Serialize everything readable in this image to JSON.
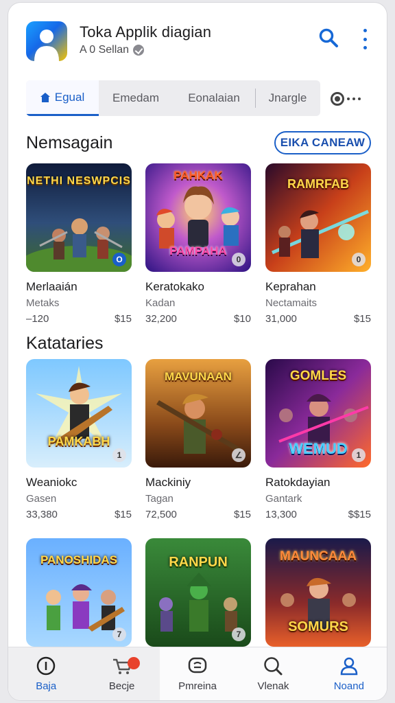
{
  "header": {
    "app_title": "Toka Applik diagian",
    "app_subtitle": "A 0 Sellan",
    "app_icon": "person-avatar-icon",
    "search_icon": "search-icon",
    "more_icon": "more-vertical-icon"
  },
  "tabs": [
    {
      "label": "Egual",
      "active": true,
      "icon": "home-icon"
    },
    {
      "label": "Emedam",
      "active": false
    },
    {
      "label": "Eonalaian",
      "active": false
    },
    {
      "label": "Jnargle",
      "active": false
    }
  ],
  "section1": {
    "title": "Nemsagain",
    "action_label": "EIKA CANEAW",
    "items": [
      {
        "name": "Merlaaián",
        "sub": "Metaks",
        "count": "–120",
        "price": "$15",
        "art_title": "NETHI NESWPCIS",
        "badge": "O"
      },
      {
        "name": "Keratokako",
        "sub": "Kadan",
        "count": "32,200",
        "price": "$10",
        "art_title": "PAHKAK",
        "art_title2": "PAMPAHA",
        "badge": "0"
      },
      {
        "name": "Keprahan",
        "sub": "Nectamaits",
        "count": "31,000",
        "price": "$15",
        "art_title": "RAMRFAB",
        "badge": "0"
      }
    ]
  },
  "section2": {
    "title": "Katataries",
    "items": [
      {
        "name": "Weaniokc",
        "sub": "Gasen",
        "count": "33,380",
        "price": "$15",
        "art_title": "PAMKABH",
        "badge": "1"
      },
      {
        "name": "Mackiniy",
        "sub": "Tagan",
        "count": "72,500",
        "price": "$15",
        "art_title": "MAVUNAAN",
        "badge": "∠"
      },
      {
        "name": "Ratokdayian",
        "sub": "Gantark",
        "count": "13,300",
        "price": "$$15",
        "art_title": "GOMLES",
        "art_title2": "WEMUD",
        "badge": "1"
      }
    ]
  },
  "section3": {
    "items": [
      {
        "art_title": "PANOSHIDAS",
        "badge": "7"
      },
      {
        "art_title": "RANPUN",
        "badge": "7"
      },
      {
        "art_title": "MAUNCAAA",
        "art_title2": "SOMURS",
        "badge": ""
      }
    ]
  },
  "bottom_nav": [
    {
      "label": "Baja",
      "icon": "info-circle-icon",
      "active": true
    },
    {
      "label": "Becje",
      "icon": "cart-icon",
      "active": false
    },
    {
      "label": "Pmreina",
      "icon": "chat-icon",
      "active": false
    },
    {
      "label": "Vlenak",
      "icon": "search-icon",
      "active": false
    },
    {
      "label": "Noand",
      "icon": "profile-icon",
      "active": false
    }
  ],
  "colors": {
    "accent": "#1a5fc8",
    "badge_red": "#e8422c"
  }
}
